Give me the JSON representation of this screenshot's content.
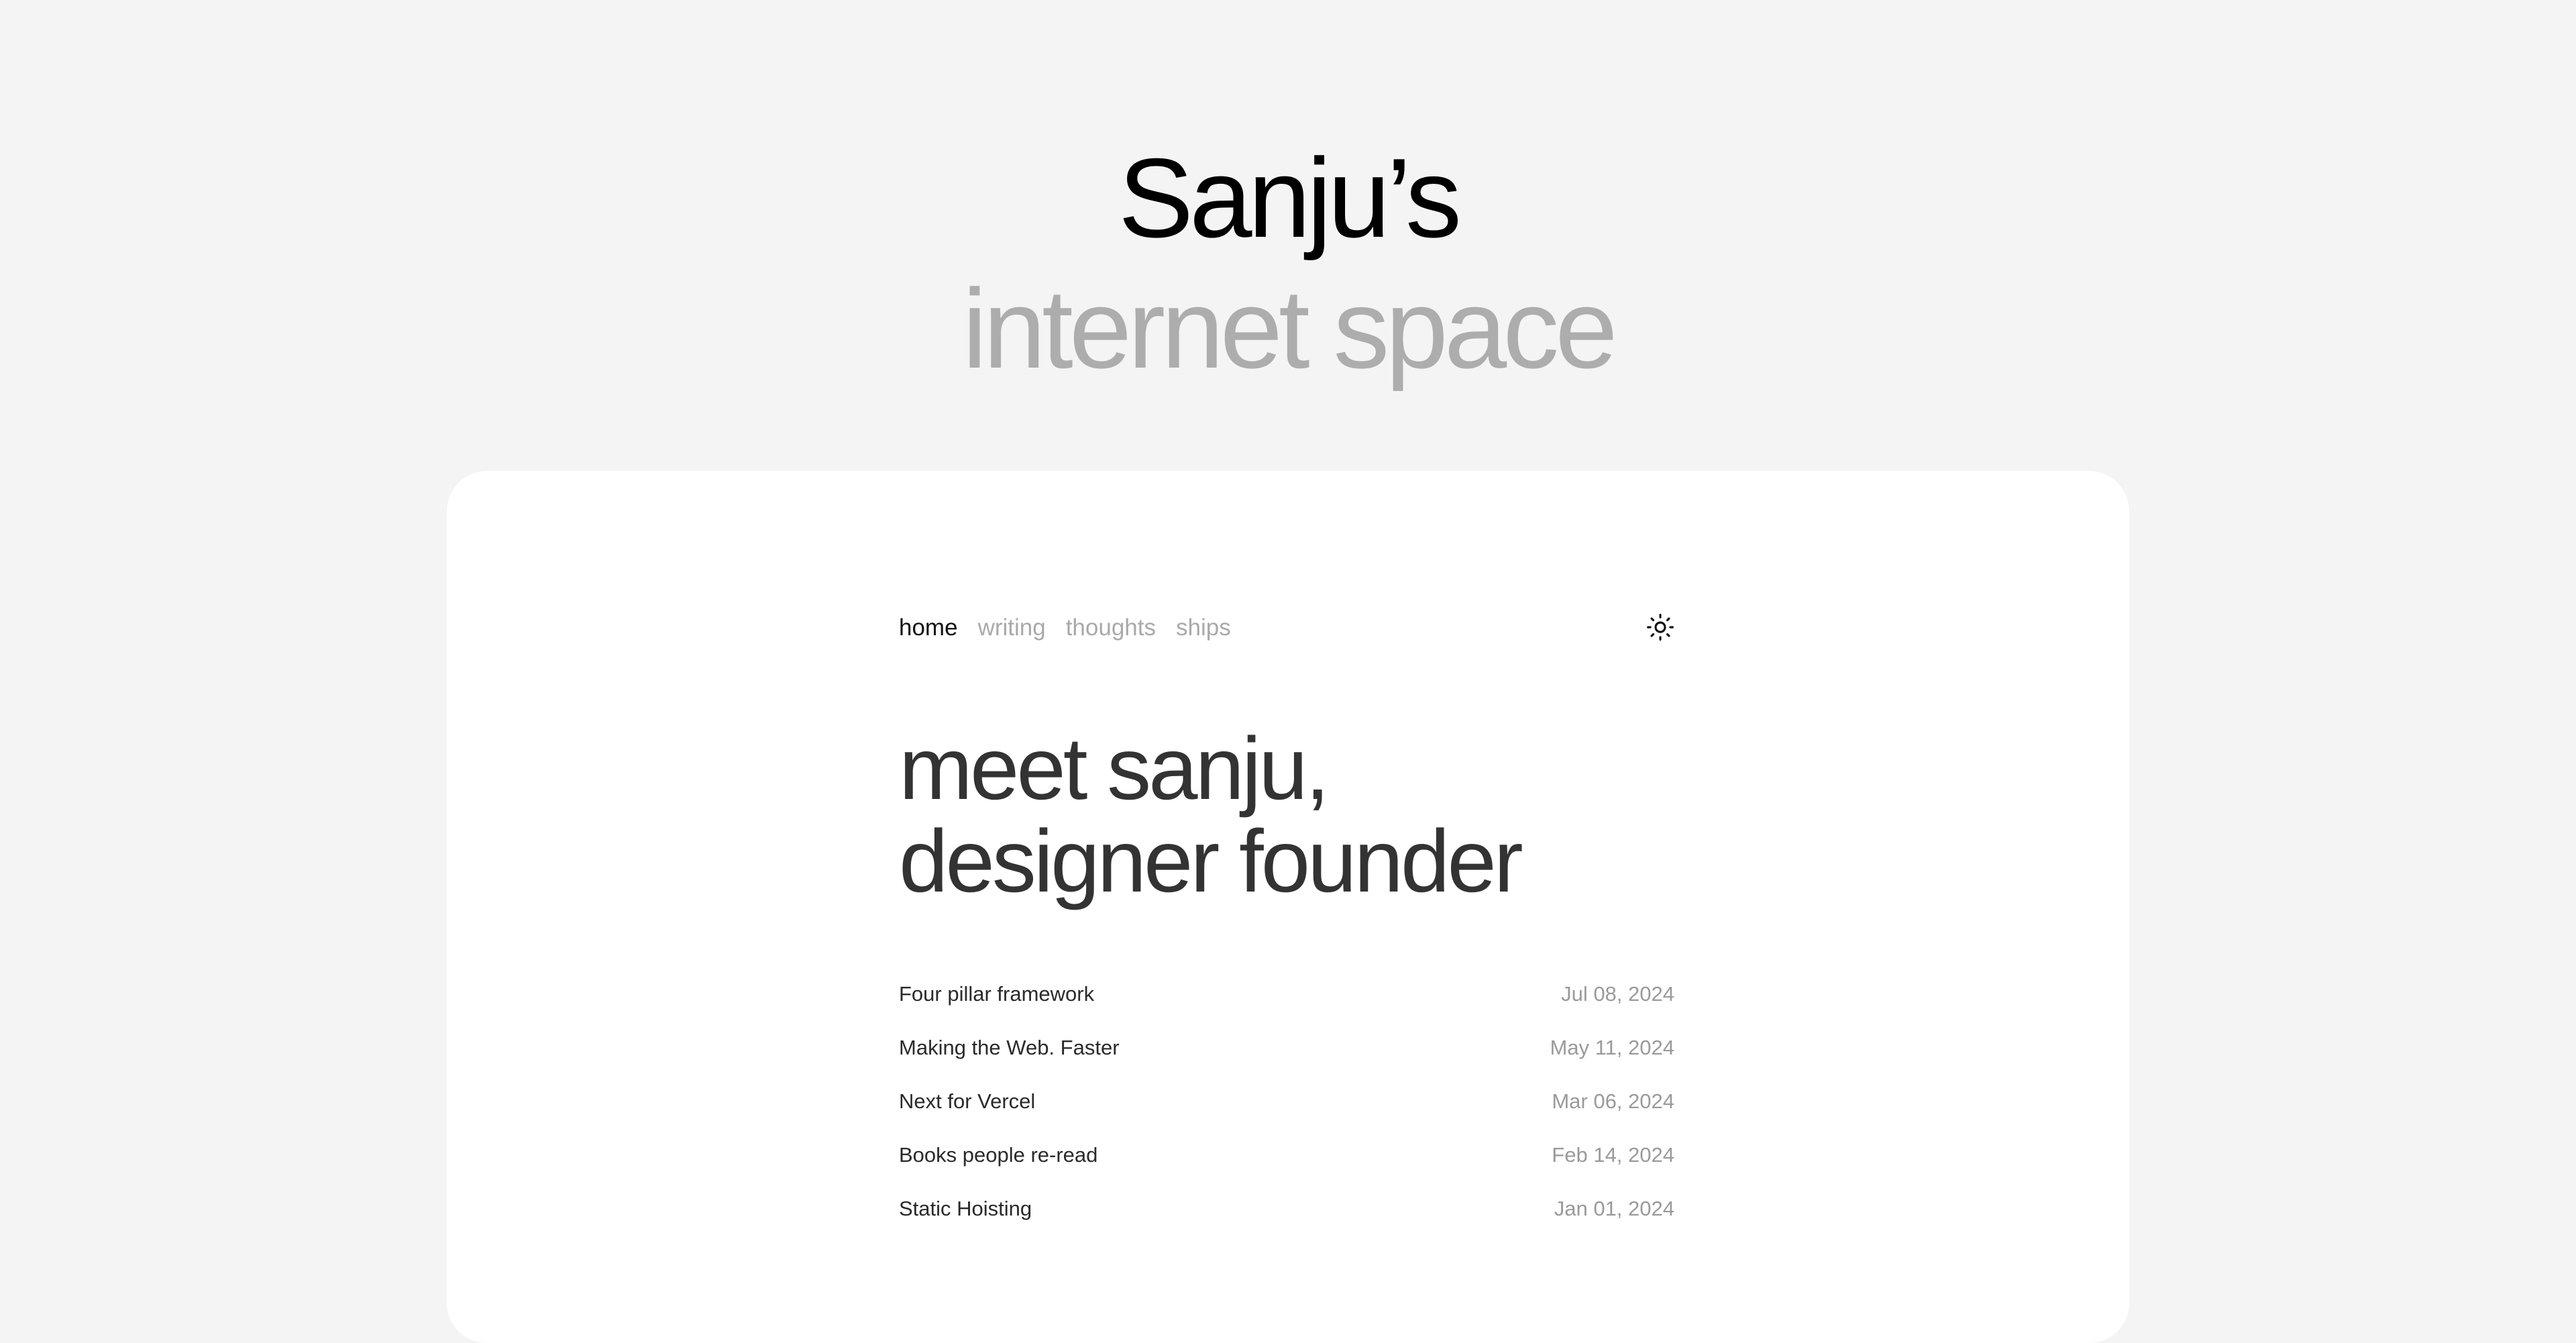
{
  "hero": {
    "title": "Sanju’s",
    "subtitle": "internet space"
  },
  "nav": {
    "items": [
      {
        "label": "home",
        "active": true
      },
      {
        "label": "writing",
        "active": false
      },
      {
        "label": "thoughts",
        "active": false
      },
      {
        "label": "ships",
        "active": false
      }
    ],
    "theme_icon": "sun-icon"
  },
  "headline": {
    "line1": "meet sanju,",
    "line2": "designer founder"
  },
  "posts": [
    {
      "title": "Four pillar framework",
      "date": "Jul 08, 2024"
    },
    {
      "title": "Making the Web. Faster",
      "date": "May 11, 2024"
    },
    {
      "title": "Next for Vercel",
      "date": "Mar 06, 2024"
    },
    {
      "title": "Books people re-read",
      "date": "Feb 14, 2024"
    },
    {
      "title": "Static Hoisting",
      "date": "Jan 01, 2024"
    }
  ],
  "colors": {
    "background": "#f4f4f4",
    "card": "#ffffff",
    "title": "#000000",
    "subtitle": "#adadad",
    "headline": "#333333",
    "muted": "#9a9a9a"
  }
}
